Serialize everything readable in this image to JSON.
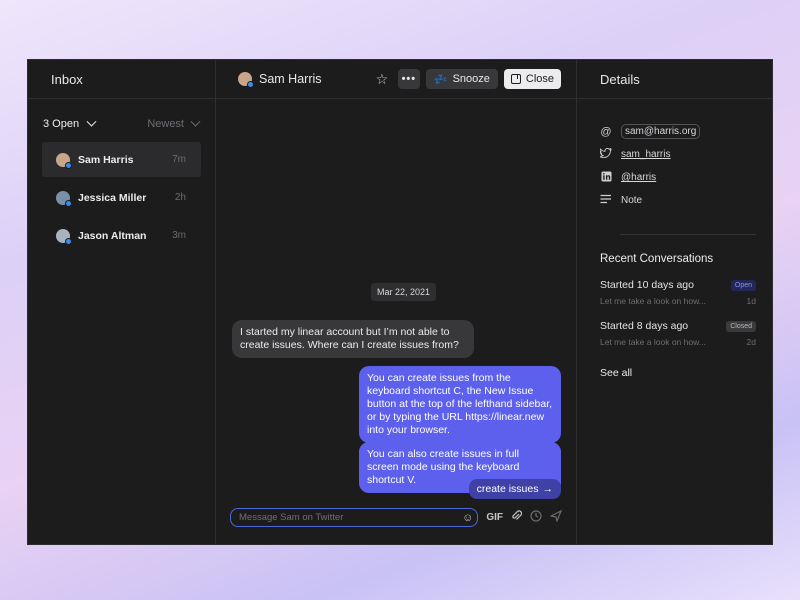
{
  "inbox": {
    "title": "Inbox",
    "filter_label": "3 Open",
    "sort_label": "Newest",
    "conversations": [
      {
        "name": "Sam Harris",
        "time": "7m",
        "avatar_color": "#c9a58a"
      },
      {
        "name": "Jessica Miller",
        "time": "2h",
        "avatar_color": "#7a8fa8"
      },
      {
        "name": "Jason Altman",
        "time": "3m",
        "avatar_color": "#a9b3bf"
      }
    ]
  },
  "conversation": {
    "contact_name": "Sam Harris",
    "star_icon": "star-icon",
    "more_label": "•••",
    "snooze_label": "Snooze",
    "close_label": "Close",
    "date": "Mar 22, 2021",
    "messages": [
      {
        "direction": "in",
        "text": "I started my linear account but I’m not able to create issues. Where can I create issues from?"
      },
      {
        "direction": "out",
        "text": "You can create issues from the keyboard shortcut C, the New Issue button at the top of the lefthand sidebar, or by typing the URL https://linear.new into your browser."
      },
      {
        "direction": "out",
        "text": "You can also create issues in full screen mode using the keyboard shortcut V."
      }
    ],
    "suggestion_chip": "create issues",
    "composer": {
      "placeholder": "Message Sam on Twitter",
      "gif_label": "GIF"
    }
  },
  "details": {
    "title": "Details",
    "email": "sam@harris.org",
    "twitter": "sam_harris",
    "linkedin": "@harris",
    "note_label": "Note",
    "recent_title": "Recent Conversations",
    "recent": [
      {
        "title": "Started 10 days ago",
        "preview": "Let me take a look on how...",
        "status": "Open",
        "age": "1d"
      },
      {
        "title": "Started 8 days ago",
        "preview": "Let me take a look on how...",
        "status": "Closed",
        "age": "2d"
      }
    ],
    "see_all_label": "See all"
  },
  "colors": {
    "accent": "#5d60ec",
    "panel": "#1c1c1d",
    "chip": "#3f41a6"
  }
}
